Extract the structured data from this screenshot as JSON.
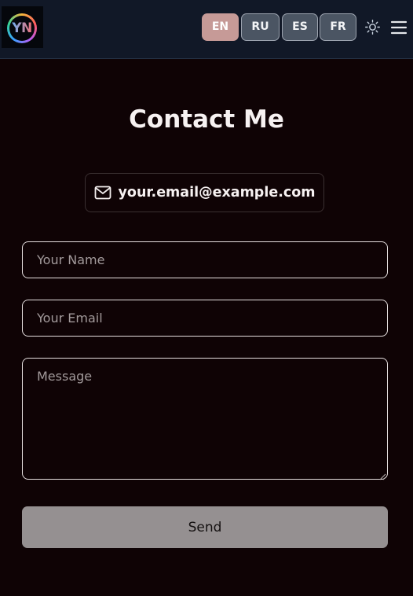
{
  "header": {
    "logo_text": "YN",
    "languages": [
      {
        "label": "EN",
        "active": true
      },
      {
        "label": "RU",
        "active": false
      },
      {
        "label": "ES",
        "active": false
      },
      {
        "label": "FR",
        "active": false
      }
    ],
    "theme_toggle_icon": "sun-icon",
    "menu_icon": "hamburger-menu-icon"
  },
  "contact": {
    "title": "Contact Me",
    "email_icon": "mail-icon",
    "email": "your.email@example.com",
    "form": {
      "name_placeholder": "Your Name",
      "name_value": "",
      "email_placeholder": "Your Email",
      "email_value": "",
      "message_placeholder": "Message",
      "message_value": "",
      "send_label": "Send"
    }
  },
  "colors": {
    "page_background": "#0f0305",
    "header_background": "#111827",
    "active_language": "#c69a97",
    "inactive_language": "#4b5563",
    "send_button": "#959091"
  }
}
